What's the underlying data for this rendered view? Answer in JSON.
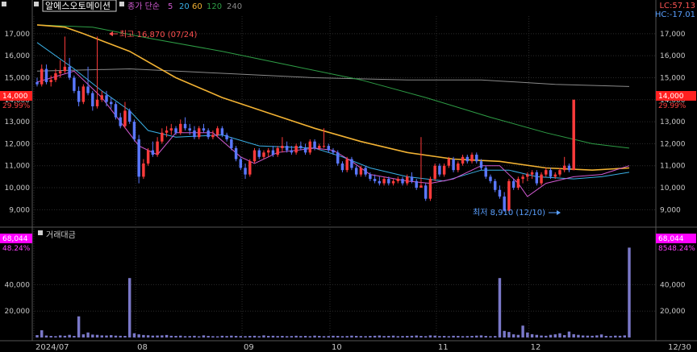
{
  "header": {
    "stock_name": "알에스오토메이션",
    "ma_label": "종가 단순",
    "ma_periods": [
      "5",
      "20",
      "60",
      "120",
      "240"
    ],
    "ma_colors": [
      "#d15ad1",
      "#3ab0e6",
      "#f2b233",
      "#2e9e46",
      "#8a8a8a"
    ],
    "lc": "LC:57.13",
    "hc": "HC:-17.01"
  },
  "annotations": {
    "high": "최고 16,870 (07/24)",
    "low": "최저 8,910 (12/10)"
  },
  "price_badge": {
    "value": "14,000",
    "change": "29.99%"
  },
  "volume_panel": {
    "title": "거래대금",
    "badge_value": "68,044",
    "badge_change": "8548.24%",
    "left_badge_change": "48.24%"
  },
  "colors": {
    "up": "#ff3b3b",
    "down": "#5a78ff",
    "volume": "#7a78c8",
    "badge": "#ff2020",
    "volume_badge": "#ff00ff",
    "grid": "#2c2c2c",
    "axis_text": "#c8c8c8"
  },
  "chart_data": [
    {
      "type": "candlestick",
      "y_ticks": [
        "17,000",
        "16,000",
        "15,000",
        "14,000",
        "13,000",
        "12,000",
        "11,000",
        "10,000",
        "9,000"
      ],
      "y_tick_values": [
        17000,
        16000,
        15000,
        14000,
        13000,
        12000,
        11000,
        10000,
        9000
      ],
      "ylim": [
        8500,
        17800
      ],
      "x_labels": [
        "2024/07",
        "08",
        "09",
        "10",
        "11",
        "12",
        "12/30"
      ],
      "x_label_days": [
        0,
        22,
        45,
        64,
        87,
        107,
        128
      ],
      "days": 129,
      "ohlc": [
        [
          14800,
          15000,
          14600,
          14700
        ],
        [
          14700,
          15600,
          14600,
          15400
        ],
        [
          15400,
          15600,
          14700,
          14800
        ],
        [
          14800,
          15100,
          14600,
          14900
        ],
        [
          14900,
          15400,
          14800,
          15200
        ],
        [
          15200,
          15800,
          15000,
          15300
        ],
        [
          15300,
          16870,
          15200,
          15500
        ],
        [
          15500,
          15900,
          14900,
          15000
        ],
        [
          15000,
          15100,
          14300,
          14400
        ],
        [
          14400,
          14600,
          13700,
          13900
        ],
        [
          13900,
          14700,
          13800,
          14600
        ],
        [
          14600,
          15500,
          14200,
          14300
        ],
        [
          14300,
          14400,
          13500,
          13700
        ],
        [
          13700,
          16870,
          13600,
          14000
        ],
        [
          14000,
          14400,
          13900,
          14200
        ],
        [
          14200,
          14400,
          13700,
          13900
        ],
        [
          13900,
          14100,
          13600,
          13800
        ],
        [
          13800,
          13900,
          13100,
          13200
        ],
        [
          13200,
          13400,
          12700,
          12800
        ],
        [
          12800,
          13900,
          12700,
          13500
        ],
        [
          13500,
          13600,
          12900,
          13000
        ],
        [
          13000,
          13100,
          12100,
          12200
        ],
        [
          12200,
          12400,
          10200,
          10500
        ],
        [
          10500,
          11300,
          10400,
          11100
        ],
        [
          11100,
          11800,
          11000,
          11700
        ],
        [
          11700,
          12100,
          11400,
          11500
        ],
        [
          11500,
          12300,
          11400,
          12100
        ],
        [
          12100,
          12700,
          12000,
          12500
        ],
        [
          12500,
          12800,
          12300,
          12600
        ],
        [
          12600,
          12900,
          12400,
          12700
        ],
        [
          12700,
          12800,
          12400,
          12500
        ],
        [
          12500,
          13100,
          12400,
          12900
        ],
        [
          12900,
          13200,
          12600,
          12700
        ],
        [
          12700,
          12900,
          12400,
          12600
        ],
        [
          12600,
          12800,
          12200,
          12300
        ],
        [
          12300,
          12800,
          12200,
          12700
        ],
        [
          12700,
          12900,
          12500,
          12600
        ],
        [
          12600,
          12700,
          12200,
          12300
        ],
        [
          12300,
          12600,
          12200,
          12400
        ],
        [
          12400,
          12800,
          12300,
          12700
        ],
        [
          12700,
          12800,
          12300,
          12400
        ],
        [
          12400,
          12500,
          12100,
          12200
        ],
        [
          12200,
          12300,
          11700,
          11800
        ],
        [
          11800,
          11900,
          11200,
          11300
        ],
        [
          11300,
          11400,
          10800,
          10900
        ],
        [
          10900,
          11100,
          10400,
          10600
        ],
        [
          10600,
          11300,
          10500,
          11200
        ],
        [
          11200,
          11800,
          11100,
          11700
        ],
        [
          11700,
          11800,
          11300,
          11400
        ],
        [
          11400,
          11700,
          11300,
          11600
        ],
        [
          11600,
          11800,
          11400,
          11700
        ],
        [
          11700,
          11900,
          11400,
          11500
        ],
        [
          11500,
          11900,
          11400,
          11800
        ],
        [
          11800,
          12300,
          11600,
          11900
        ],
        [
          11900,
          12100,
          11600,
          11700
        ],
        [
          11700,
          11900,
          11500,
          11600
        ],
        [
          11600,
          12000,
          11500,
          11900
        ],
        [
          11900,
          12100,
          11700,
          11800
        ],
        [
          11800,
          12000,
          11500,
          11600
        ],
        [
          11600,
          12200,
          11500,
          12100
        ],
        [
          12100,
          12200,
          11700,
          11800
        ],
        [
          11800,
          12000,
          11700,
          11900
        ],
        [
          11900,
          12700,
          11800,
          11900
        ],
        [
          11900,
          12000,
          11600,
          11700
        ],
        [
          11700,
          11800,
          11500,
          11600
        ],
        [
          11600,
          11700,
          11000,
          11100
        ],
        [
          11100,
          11200,
          10700,
          10800
        ],
        [
          10800,
          11400,
          10700,
          11300
        ],
        [
          11300,
          11400,
          10800,
          10900
        ],
        [
          10900,
          11000,
          10500,
          10600
        ],
        [
          10600,
          11000,
          10500,
          10900
        ],
        [
          10900,
          11000,
          10500,
          10600
        ],
        [
          10600,
          10700,
          10300,
          10400
        ],
        [
          10400,
          10600,
          10200,
          10300
        ],
        [
          10300,
          10500,
          10100,
          10200
        ],
        [
          10200,
          10500,
          10100,
          10400
        ],
        [
          10400,
          10500,
          10100,
          10200
        ],
        [
          10200,
          10400,
          10100,
          10300
        ],
        [
          10300,
          10500,
          10200,
          10400
        ],
        [
          10400,
          10500,
          10100,
          10200
        ],
        [
          10200,
          10600,
          10100,
          10500
        ],
        [
          10500,
          10700,
          10200,
          10300
        ],
        [
          10300,
          10400,
          9900,
          10000
        ],
        [
          10000,
          12300,
          10000,
          10100
        ],
        [
          10100,
          10200,
          9400,
          9500
        ],
        [
          9500,
          10500,
          9400,
          10400
        ],
        [
          10400,
          11100,
          10300,
          11000
        ],
        [
          11000,
          11100,
          10500,
          10600
        ],
        [
          10600,
          11100,
          10500,
          11000
        ],
        [
          11000,
          11400,
          10900,
          11300
        ],
        [
          11300,
          11400,
          10700,
          10800
        ],
        [
          10800,
          11200,
          10700,
          11100
        ],
        [
          11100,
          11500,
          11000,
          11400
        ],
        [
          11400,
          11500,
          11100,
          11200
        ],
        [
          11200,
          11600,
          11100,
          11500
        ],
        [
          11500,
          11600,
          11100,
          11200
        ],
        [
          11200,
          11300,
          10800,
          10900
        ],
        [
          10900,
          11000,
          10400,
          10500
        ],
        [
          10500,
          10600,
          10200,
          10300
        ],
        [
          10300,
          10400,
          9800,
          9900
        ],
        [
          9900,
          10100,
          9500,
          9600
        ],
        [
          9600,
          9800,
          8910,
          8950
        ],
        [
          8950,
          10400,
          8910,
          10300
        ],
        [
          10300,
          10400,
          9900,
          10000
        ],
        [
          10000,
          10500,
          9900,
          10400
        ],
        [
          10400,
          10600,
          10200,
          10500
        ],
        [
          10500,
          10700,
          10300,
          10600
        ],
        [
          10600,
          10800,
          10400,
          10700
        ],
        [
          10700,
          10800,
          10100,
          10200
        ],
        [
          10200,
          10700,
          10100,
          10600
        ],
        [
          10600,
          10900,
          10500,
          10800
        ],
        [
          10800,
          10900,
          10400,
          10500
        ],
        [
          10500,
          10700,
          10400,
          10600
        ],
        [
          10600,
          10900,
          10500,
          10800
        ],
        [
          10800,
          11400,
          10700,
          11000
        ],
        [
          11000,
          11100,
          10700,
          10800
        ],
        [
          10800,
          14000,
          10800,
          14000
        ]
      ],
      "ma": {
        "5": [
          [
            0,
            14800
          ],
          [
            8,
            15300
          ],
          [
            14,
            14100
          ],
          [
            22,
            11900
          ],
          [
            26,
            11500
          ],
          [
            30,
            12500
          ],
          [
            38,
            12500
          ],
          [
            44,
            11400
          ],
          [
            47,
            11100
          ],
          [
            52,
            11600
          ],
          [
            60,
            11800
          ],
          [
            64,
            11700
          ],
          [
            68,
            11200
          ],
          [
            72,
            10600
          ],
          [
            80,
            10300
          ],
          [
            85,
            10200
          ],
          [
            90,
            10400
          ],
          [
            96,
            11000
          ],
          [
            100,
            11000
          ],
          [
            104,
            10200
          ],
          [
            106,
            9600
          ],
          [
            110,
            10200
          ],
          [
            116,
            10500
          ],
          [
            122,
            10600
          ],
          [
            128,
            11000
          ]
        ],
        "20": [
          [
            0,
            16600
          ],
          [
            8,
            15400
          ],
          [
            14,
            14400
          ],
          [
            20,
            13500
          ],
          [
            24,
            12600
          ],
          [
            30,
            12300
          ],
          [
            40,
            12400
          ],
          [
            48,
            11900
          ],
          [
            60,
            11800
          ],
          [
            66,
            11400
          ],
          [
            72,
            10900
          ],
          [
            80,
            10500
          ],
          [
            88,
            10300
          ],
          [
            96,
            10800
          ],
          [
            102,
            10800
          ],
          [
            108,
            10500
          ],
          [
            116,
            10400
          ],
          [
            122,
            10500
          ],
          [
            128,
            10700
          ]
        ],
        "60": [
          [
            0,
            17400
          ],
          [
            6,
            17300
          ],
          [
            10,
            17000
          ],
          [
            20,
            16200
          ],
          [
            30,
            15000
          ],
          [
            40,
            14100
          ],
          [
            50,
            13400
          ],
          [
            60,
            12700
          ],
          [
            70,
            12100
          ],
          [
            80,
            11600
          ],
          [
            90,
            11300
          ],
          [
            100,
            11200
          ],
          [
            110,
            10900
          ],
          [
            120,
            10800
          ],
          [
            128,
            10900
          ]
        ],
        "120": [
          [
            0,
            17400
          ],
          [
            12,
            17300
          ],
          [
            24,
            16800
          ],
          [
            40,
            16200
          ],
          [
            56,
            15500
          ],
          [
            70,
            14900
          ],
          [
            84,
            14100
          ],
          [
            98,
            13200
          ],
          [
            110,
            12500
          ],
          [
            120,
            12000
          ],
          [
            128,
            11800
          ]
        ],
        "240": [
          [
            0,
            15300
          ],
          [
            20,
            15400
          ],
          [
            40,
            15200
          ],
          [
            60,
            15000
          ],
          [
            80,
            14900
          ],
          [
            96,
            14900
          ],
          [
            112,
            14700
          ],
          [
            128,
            14600
          ]
        ]
      }
    },
    {
      "type": "bar",
      "title": "거래대금",
      "y_ticks": [
        "40,000",
        "20,000"
      ],
      "y_tick_values": [
        40000,
        20000
      ],
      "ylim": [
        0,
        75000
      ],
      "values": [
        1800,
        5500,
        1500,
        1200,
        1000,
        1600,
        1300,
        2000,
        1200,
        16000,
        2400,
        3800,
        2200,
        2000,
        1600,
        1500,
        1800,
        1400,
        1300,
        1200,
        45000,
        3200,
        2400,
        1900,
        1700,
        1400,
        1500,
        1600,
        1900,
        1300,
        1200,
        1400,
        1000,
        1100,
        1300,
        900,
        1600,
        1200,
        1000,
        900,
        1300,
        1100,
        1400,
        1200,
        1100,
        1000,
        1200,
        1300,
        1000,
        1600,
        1200,
        1300,
        1100,
        1200,
        1000,
        1100,
        1300,
        1100,
        1200,
        1000,
        1400,
        1200,
        1000,
        1100,
        1300,
        1200,
        1000,
        1100,
        1400,
        1200,
        1100,
        1000,
        1200,
        1300,
        1500,
        1100,
        1200,
        1400,
        1000,
        1100,
        1200,
        1300,
        1500,
        1200,
        1000,
        1600,
        1400,
        1100,
        1200,
        1000,
        1300,
        1200,
        1000,
        1100,
        1200,
        1400,
        1600,
        1200,
        1000,
        1100,
        45000,
        5000,
        4200,
        2400,
        2000,
        9000,
        3800,
        2500,
        2000,
        1500,
        1300,
        2000,
        2400,
        3200,
        1800,
        4500,
        2500,
        2000,
        1500,
        1400,
        1300,
        1600,
        2300,
        1200,
        1100,
        1400,
        1300,
        1600,
        68044
      ]
    }
  ]
}
